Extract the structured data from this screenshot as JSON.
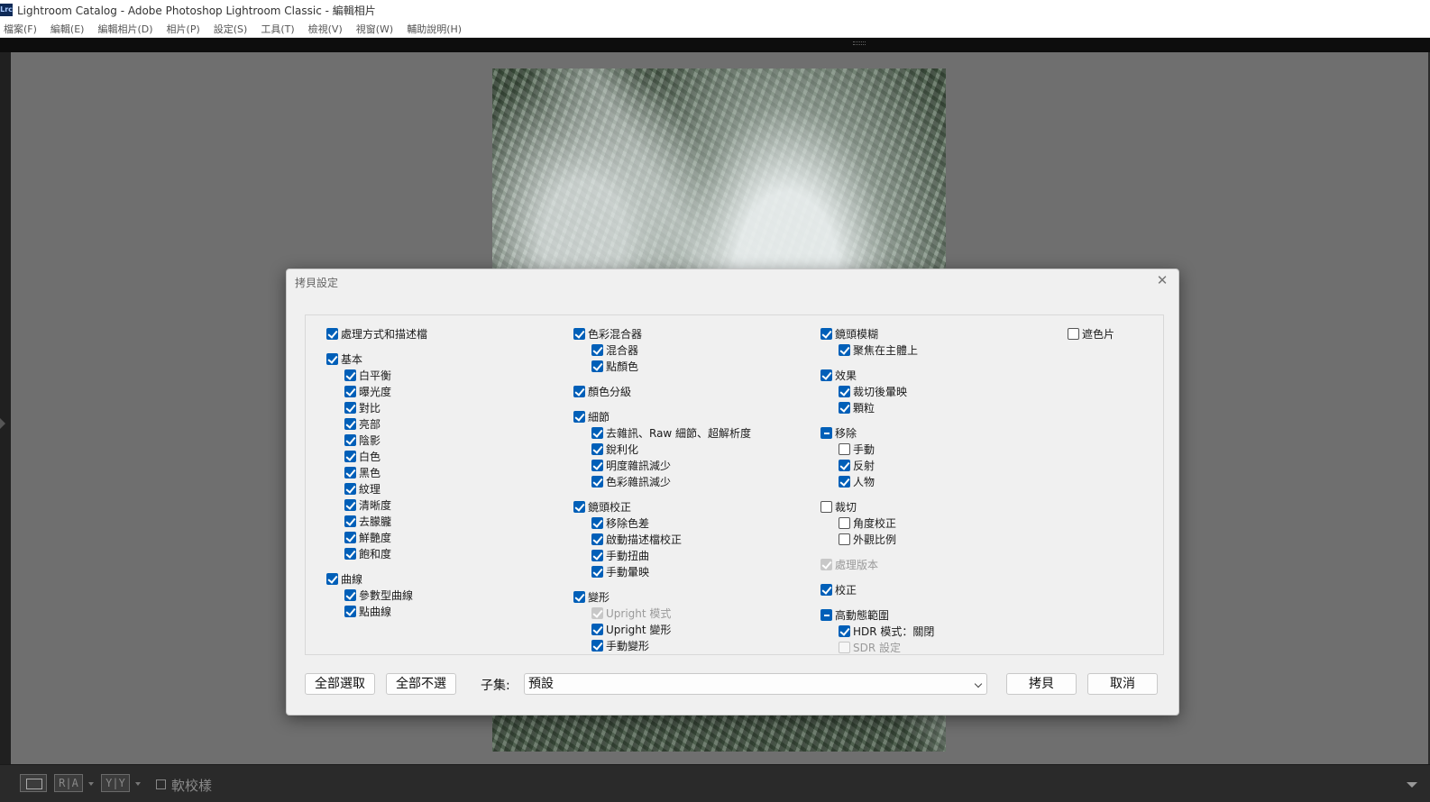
{
  "window": {
    "app_icon": "Lrc",
    "title": "Lightroom Catalog - Adobe Photoshop Lightroom Classic - 編輯相片"
  },
  "menu": [
    "檔案(F)",
    "編輯(E)",
    "編輯相片(D)",
    "相片(P)",
    "設定(S)",
    "工具(T)",
    "檢視(V)",
    "視窗(W)",
    "輔助說明(H)"
  ],
  "toolbar": {
    "ra_label": "R|A",
    "yy_label": "Y|Y",
    "soft_proof_label": "軟校樣",
    "soft_proof_checked": false
  },
  "dialog": {
    "title": "拷貝設定",
    "close_icon": "close-icon",
    "col1": {
      "process": {
        "label": "處理方式和描述檔",
        "state": "on"
      },
      "basic": {
        "label": "基本",
        "state": "on"
      },
      "basic_items": [
        {
          "label": "白平衡",
          "state": "on"
        },
        {
          "label": "曝光度",
          "state": "on"
        },
        {
          "label": "對比",
          "state": "on"
        },
        {
          "label": "亮部",
          "state": "on"
        },
        {
          "label": "陰影",
          "state": "on"
        },
        {
          "label": "白色",
          "state": "on"
        },
        {
          "label": "黑色",
          "state": "on"
        },
        {
          "label": "紋理",
          "state": "on"
        },
        {
          "label": "清晰度",
          "state": "on"
        },
        {
          "label": "去朦朧",
          "state": "on"
        },
        {
          "label": "鮮艷度",
          "state": "on"
        },
        {
          "label": "飽和度",
          "state": "on"
        }
      ],
      "curve": {
        "label": "曲線",
        "state": "on"
      },
      "curve_items": [
        {
          "label": "參數型曲線",
          "state": "on"
        },
        {
          "label": "點曲線",
          "state": "on"
        }
      ]
    },
    "col2": {
      "color_mixer": {
        "label": "色彩混合器",
        "state": "on"
      },
      "color_mixer_items": [
        {
          "label": "混合器",
          "state": "on"
        },
        {
          "label": "點顏色",
          "state": "on"
        }
      ],
      "color_grading": {
        "label": "顏色分級",
        "state": "on"
      },
      "detail": {
        "label": "細節",
        "state": "on"
      },
      "detail_items": [
        {
          "label": "去雜訊、Raw 細節、超解析度",
          "state": "on"
        },
        {
          "label": "銳利化",
          "state": "on"
        },
        {
          "label": "明度雜訊減少",
          "state": "on"
        },
        {
          "label": "色彩雜訊減少",
          "state": "on"
        }
      ],
      "lens": {
        "label": "鏡頭校正",
        "state": "on"
      },
      "lens_items": [
        {
          "label": "移除色差",
          "state": "on"
        },
        {
          "label": "啟動描述檔校正",
          "state": "on"
        },
        {
          "label": "手動扭曲",
          "state": "on"
        },
        {
          "label": "手動暈映",
          "state": "on"
        }
      ],
      "transform": {
        "label": "變形",
        "state": "on"
      },
      "transform_items": [
        {
          "label": "Upright 模式",
          "state": "dis-on"
        },
        {
          "label": "Upright 變形",
          "state": "on"
        },
        {
          "label": "手動變形",
          "state": "on"
        }
      ]
    },
    "col3": {
      "lens_blur": {
        "label": "鏡頭模糊",
        "state": "on"
      },
      "lens_blur_items": [
        {
          "label": "聚焦在主體上",
          "state": "on"
        }
      ],
      "effects": {
        "label": "效果",
        "state": "on"
      },
      "effects_items": [
        {
          "label": "裁切後暈映",
          "state": "on"
        },
        {
          "label": "顆粒",
          "state": "on"
        }
      ],
      "remove": {
        "label": "移除",
        "state": "mixed"
      },
      "remove_items": [
        {
          "label": "手動",
          "state": "off"
        },
        {
          "label": "反射",
          "state": "on"
        },
        {
          "label": "人物",
          "state": "on"
        }
      ],
      "crop": {
        "label": "裁切",
        "state": "off"
      },
      "crop_items": [
        {
          "label": "角度校正",
          "state": "off"
        },
        {
          "label": "外觀比例",
          "state": "off"
        }
      ],
      "process_version": {
        "label": "處理版本",
        "state": "dis-on"
      },
      "calibration": {
        "label": "校正",
        "state": "on"
      },
      "hdr": {
        "label": "高動態範圍",
        "state": "mixed"
      },
      "hdr_items": [
        {
          "label": "HDR 模式：關閉",
          "state": "on"
        },
        {
          "label": "SDR 設定",
          "state": "dis-off"
        }
      ]
    },
    "col4": {
      "masks": {
        "label": "遮色片",
        "state": "off"
      }
    },
    "buttons": {
      "select_all": "全部選取",
      "select_none": "全部不選",
      "copy": "拷貝",
      "cancel": "取消"
    },
    "subset": {
      "label": "子集:",
      "value": "預設"
    }
  }
}
